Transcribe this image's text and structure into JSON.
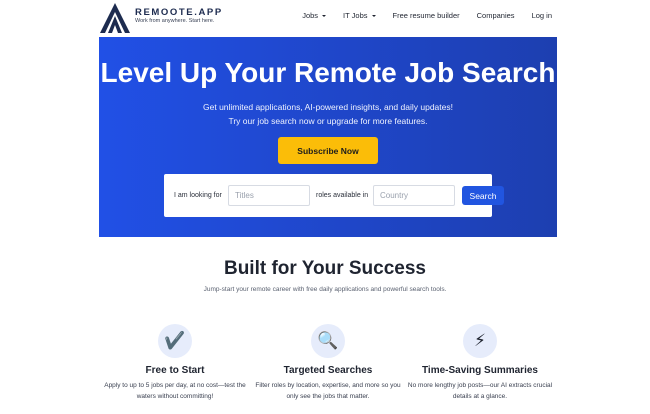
{
  "header": {
    "brand_name": "REMOOTE.APP",
    "brand_tagline": "Work from anywhere. Start here.",
    "nav": [
      {
        "label": "Jobs",
        "dropdown": true
      },
      {
        "label": "IT Jobs",
        "dropdown": true
      },
      {
        "label": "Free resume builder",
        "dropdown": false
      },
      {
        "label": "Companies",
        "dropdown": false
      },
      {
        "label": "Log in",
        "dropdown": false
      }
    ]
  },
  "hero": {
    "title": "Level Up Your Remote Job Search",
    "subtitle_line1": "Get unlimited applications, AI-powered insights, and daily updates!",
    "subtitle_line2": "Try our job search now or upgrade for more features.",
    "subscribe_label": "Subscribe Now",
    "search": {
      "looking_for_label": "I am looking for",
      "titles_placeholder": "Titles",
      "roles_label": "roles available in",
      "country_placeholder": "Country",
      "button_label": "Search"
    }
  },
  "features_section": {
    "title": "Built for Your Success",
    "subtitle": "Jump-start your remote career with free daily applications and powerful search tools.",
    "items": [
      {
        "icon": "checkmark-icon",
        "glyph": "✔️",
        "title": "Free to Start",
        "description": "Apply to up to 5 jobs per day, at no cost—test the waters without committing!"
      },
      {
        "icon": "magnifier-icon",
        "glyph": "🔍",
        "title": "Targeted Searches",
        "description": "Filter roles by location, expertise, and more so you only see the jobs that matter."
      },
      {
        "icon": "lightning-icon",
        "glyph": "⚡",
        "title": "Time-Saving Summaries",
        "description": "No more lengthy job posts—our AI extracts crucial details at a glance."
      }
    ]
  },
  "colors": {
    "brand_navy": "#1d2b4f",
    "hero_blue": "#2150e6",
    "accent_yellow": "#fbbd08",
    "button_blue": "#2155e0"
  }
}
